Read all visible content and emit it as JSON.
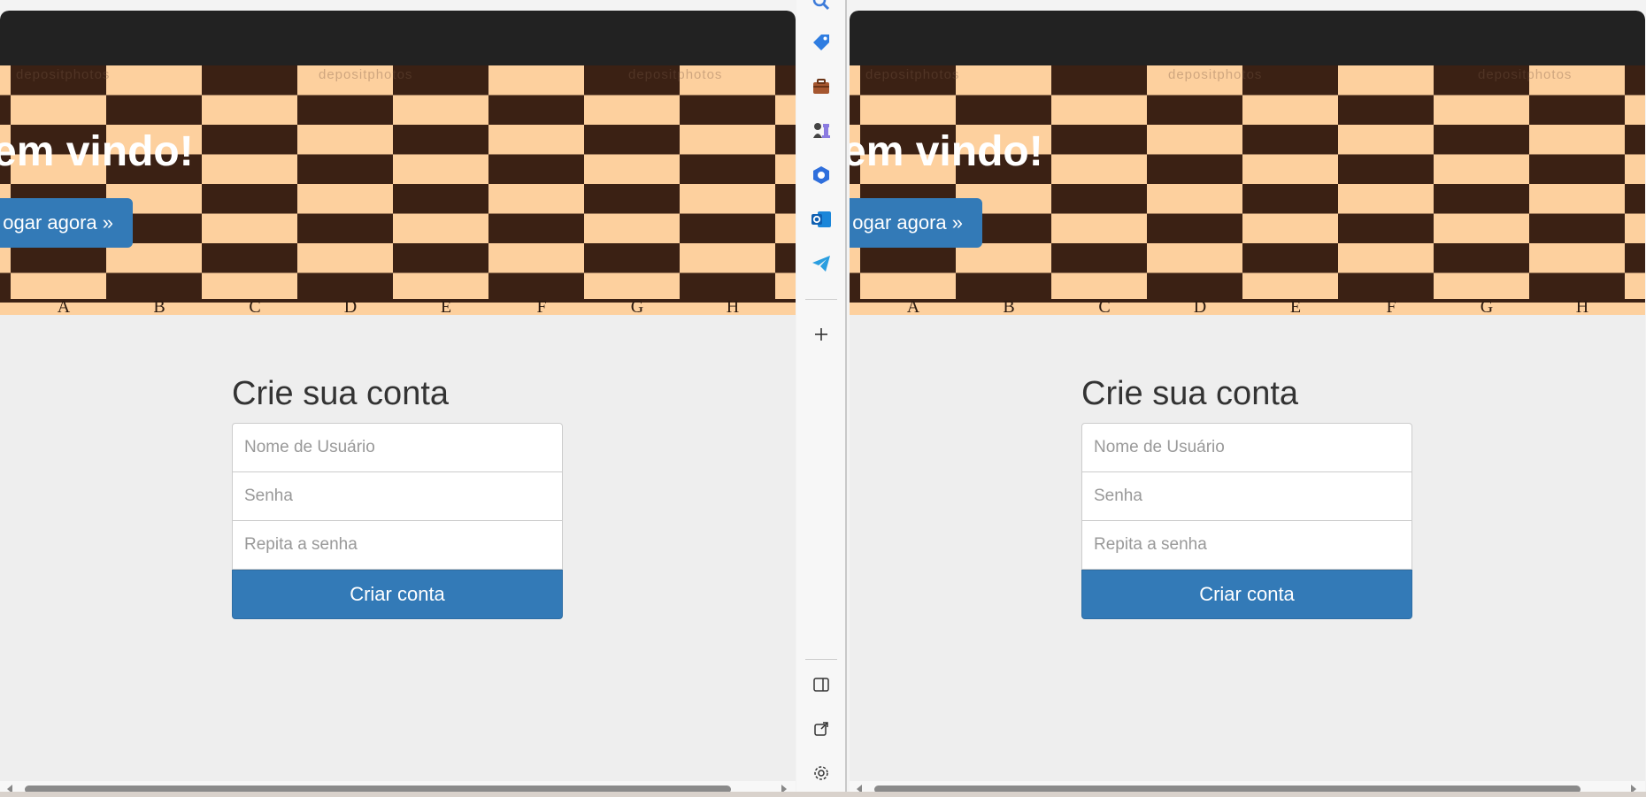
{
  "panes": [
    {
      "hero": {
        "title": "em vindo!",
        "button_label": "ogar agora »",
        "board_files": [
          "A",
          "B",
          "C",
          "D",
          "E",
          "F",
          "G",
          "H"
        ],
        "watermark": "depositphotos"
      },
      "form": {
        "title": "Crie sua conta",
        "username_placeholder": "Nome de Usuário",
        "password_placeholder": "Senha",
        "repeat_placeholder": "Repita a senha",
        "submit_label": "Criar conta"
      }
    },
    {
      "hero": {
        "title": "em vindo!",
        "button_label": "ogar agora »",
        "board_files": [
          "A",
          "B",
          "C",
          "D",
          "E",
          "F",
          "G",
          "H"
        ],
        "watermark": "depositphotos"
      },
      "form": {
        "title": "Crie sua conta",
        "username_placeholder": "Nome de Usuário",
        "password_placeholder": "Senha",
        "repeat_placeholder": "Repita a senha",
        "submit_label": "Criar conta"
      }
    }
  ],
  "sidebar": {
    "icons": [
      "search-icon",
      "shopping-tag-icon",
      "briefcase-icon",
      "chess-icon",
      "copilot-icon",
      "outlook-icon",
      "telegram-icon",
      "add-icon",
      "split-screen-icon",
      "open-external-icon",
      "settings-icon"
    ]
  },
  "colors": {
    "navbar": "#222222",
    "board_light": "#fdd09e",
    "board_dark": "#3b2114",
    "primary_button": "#337ab7",
    "page_background": "#eeeeee"
  }
}
